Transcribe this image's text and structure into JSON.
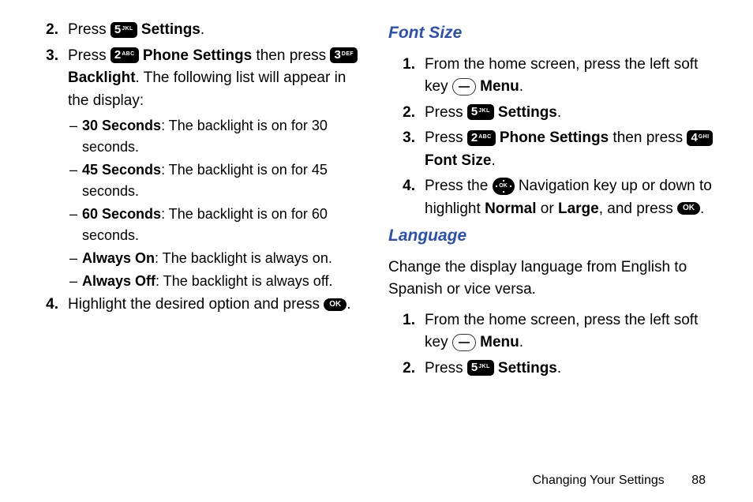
{
  "left": {
    "step2": {
      "num": "2.",
      "press": "Press ",
      "key5": {
        "main": "5",
        "sub": "JKL"
      },
      "settings": " Settings",
      "dot": "."
    },
    "step3": {
      "num": "3.",
      "press": "Press ",
      "key2": {
        "main": "2",
        "sub": "ABC"
      },
      "phoneSettings": " Phone Settings",
      "then": " then press ",
      "key3": {
        "main": "3",
        "sub": "DEF"
      },
      "backlight": " Backlight",
      "rest": ". The following list will appear in the display:"
    },
    "subs": [
      {
        "b": "30 Seconds",
        "rest": ": The backlight is on for 30 seconds."
      },
      {
        "b": "45 Seconds",
        "rest": ": The backlight is on for 45 seconds."
      },
      {
        "b": "60 Seconds",
        "rest": ": The backlight is on for 60 seconds."
      },
      {
        "b": "Always On",
        "rest": ": The backlight is always on."
      },
      {
        "b": "Always Off",
        "rest": ": The backlight is always off."
      }
    ],
    "step4": {
      "num": "4.",
      "text": "Highlight the desired option and press ",
      "ok": "OK",
      "dot": "."
    }
  },
  "right": {
    "h1": "Font Size",
    "fs1": {
      "num": "1.",
      "text1": "From the home screen, press the left soft key ",
      "menu": " Menu",
      "dot": "."
    },
    "fs2": {
      "num": "2.",
      "press": "Press ",
      "key5": {
        "main": "5",
        "sub": "JKL"
      },
      "settings": " Settings",
      "dot": "."
    },
    "fs3": {
      "num": "3.",
      "press": "Press ",
      "key2": {
        "main": "2",
        "sub": "ABC"
      },
      "phoneSettings": " Phone Settings",
      "then": " then press ",
      "key4": {
        "main": "4",
        "sub": "GHI"
      },
      "fontsize": " Font Size",
      "dot": "."
    },
    "fs4": {
      "num": "4.",
      "t1": "Press the ",
      "t2": " Navigation key up or down to highlight ",
      "normal": "Normal",
      "or": " or ",
      "large": "Large",
      "t3": ", and press ",
      "ok": "OK",
      "dot": "."
    },
    "h2": "Language",
    "intro": "Change the display language from English to Spanish or vice versa.",
    "lg1": {
      "num": "1.",
      "text1": "From the home screen, press the left soft key ",
      "menu": " Menu",
      "dot": "."
    },
    "lg2": {
      "num": "2.",
      "press": "Press ",
      "key5": {
        "main": "5",
        "sub": "JKL"
      },
      "settings": " Settings",
      "dot": "."
    }
  },
  "footer": {
    "title": "Changing Your Settings",
    "page": "88"
  }
}
